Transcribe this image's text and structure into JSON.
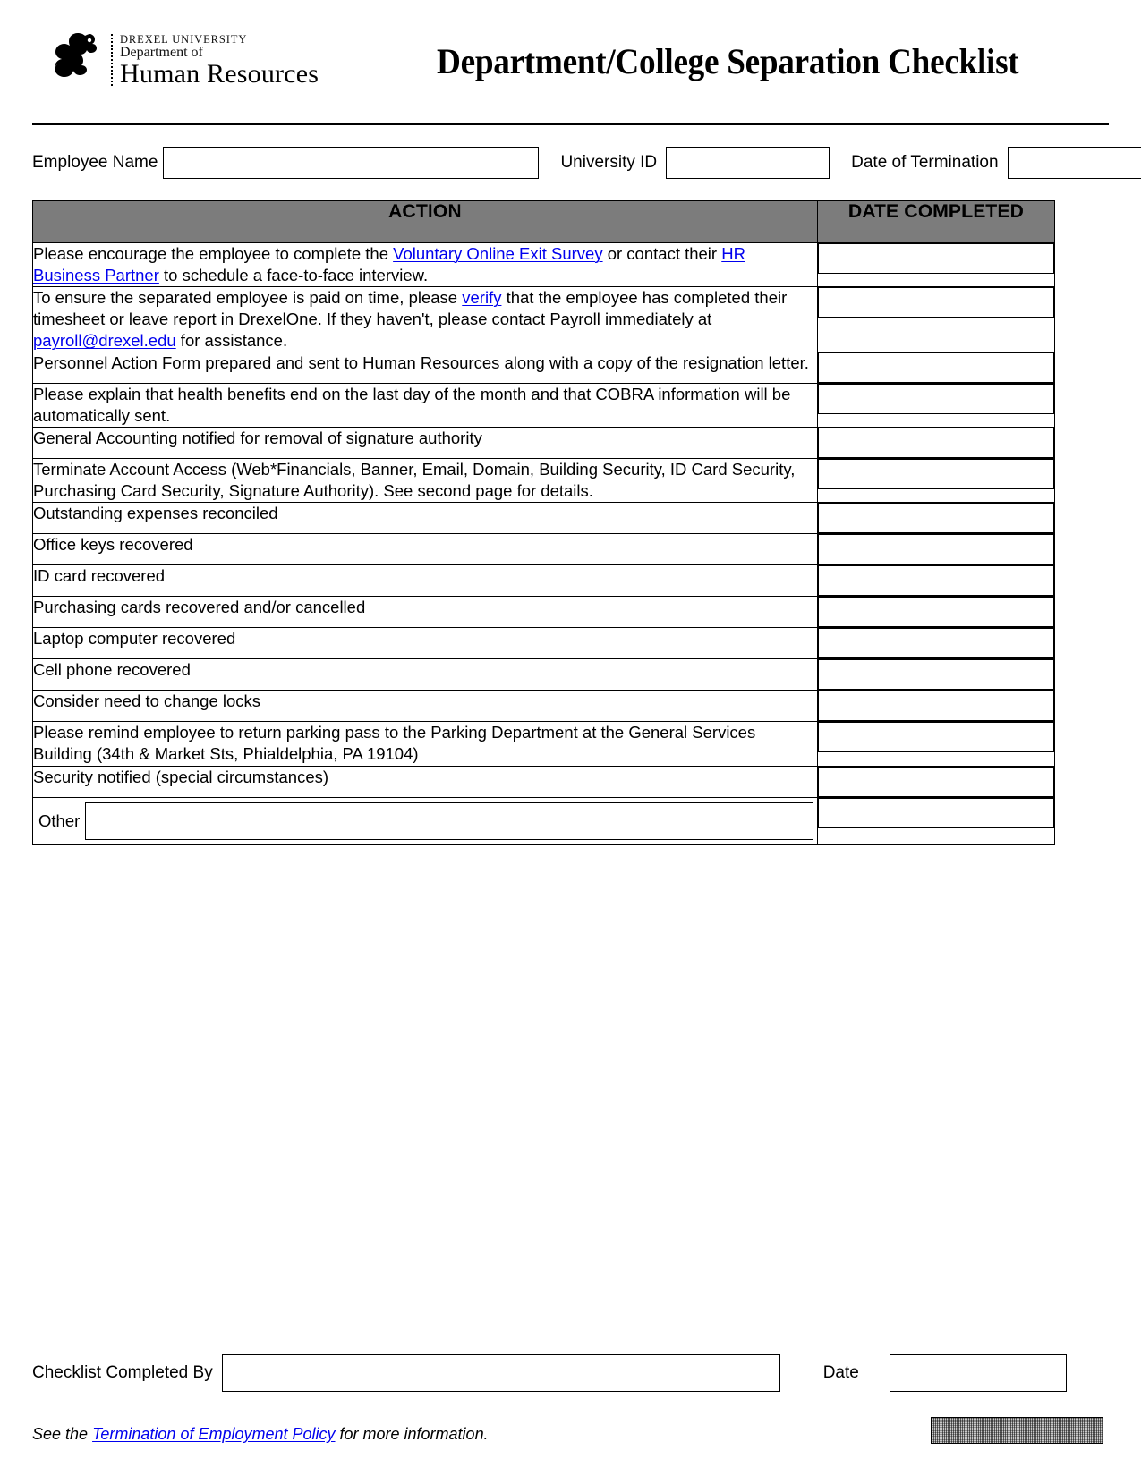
{
  "header": {
    "logo": {
      "line1": "DREXEL UNIVERSITY",
      "line2": "Department of",
      "line3": "Human Resources",
      "mark": "drexel-dragon-logo"
    },
    "title": "Department/College Separation Checklist"
  },
  "top_fields": {
    "employee_name_label": "Employee Name",
    "employee_name_value": "",
    "university_id_label": "University ID",
    "university_id_value": "",
    "date_of_termination_label": "Date of Termination",
    "date_of_termination_value": ""
  },
  "table": {
    "columns": {
      "action": "ACTION",
      "date_completed": "DATE COMPLETED"
    },
    "rows": [
      {
        "id": "exit-survey",
        "segments": [
          {
            "text": "Please encourage the employee to complete the ",
            "link": false
          },
          {
            "text": "Voluntary Online Exit Survey",
            "link": true
          },
          {
            "text": " or contact their ",
            "link": false
          },
          {
            "text": "HR Business Partner",
            "link": true
          },
          {
            "text": " to schedule a face-to-face interview.",
            "link": false
          }
        ],
        "date_value": ""
      },
      {
        "id": "timesheet-payroll",
        "segments": [
          {
            "text": "To ensure the separated employee is paid on time,  please ",
            "link": false
          },
          {
            "text": "verify",
            "link": true
          },
          {
            "text": " that the employee has completed their timesheet or leave report in DrexelOne. If they haven't, please contact Payroll immediately at ",
            "link": false
          },
          {
            "text": "payroll@drexel.edu",
            "link": true
          },
          {
            "text": " for assistance.",
            "link": false
          }
        ],
        "date_value": ""
      },
      {
        "id": "personnel-action-form",
        "segments": [
          {
            "text": "Personnel Action Form prepared and sent to Human Resources along with a copy of the resignation letter.",
            "link": false
          }
        ],
        "date_value": ""
      },
      {
        "id": "health-benefits-cobra",
        "segments": [
          {
            "text": "Please explain that health benefits end on the last day of the month and that COBRA information will be automatically sent.",
            "link": false
          }
        ],
        "date_value": ""
      },
      {
        "id": "general-accounting",
        "segments": [
          {
            "text": "General Accounting notified for removal of signature authority",
            "link": false
          }
        ],
        "date_value": ""
      },
      {
        "id": "terminate-account-access",
        "segments": [
          {
            "text": "Terminate Account Access (Web*Financials, Banner, Email, Domain, Building Security, ID Card Security, Purchasing Card Security, Signature Authority).  See second page for details.",
            "link": false
          }
        ],
        "date_value": ""
      },
      {
        "id": "expenses-reconciled",
        "segments": [
          {
            "text": "Outstanding expenses reconciled",
            "link": false
          }
        ],
        "date_value": ""
      },
      {
        "id": "office-keys",
        "segments": [
          {
            "text": "Office keys recovered",
            "link": false
          }
        ],
        "date_value": ""
      },
      {
        "id": "id-card",
        "segments": [
          {
            "text": "ID card recovered",
            "link": false
          }
        ],
        "date_value": ""
      },
      {
        "id": "purchasing-cards",
        "segments": [
          {
            "text": "Purchasing cards recovered and/or cancelled",
            "link": false
          }
        ],
        "date_value": ""
      },
      {
        "id": "laptop",
        "segments": [
          {
            "text": "Laptop computer recovered",
            "link": false
          }
        ],
        "date_value": ""
      },
      {
        "id": "cell-phone",
        "segments": [
          {
            "text": "Cell phone recovered",
            "link": false
          }
        ],
        "date_value": ""
      },
      {
        "id": "change-locks",
        "segments": [
          {
            "text": "Consider need to change locks",
            "link": false
          }
        ],
        "date_value": ""
      },
      {
        "id": "parking-pass",
        "segments": [
          {
            "text": "Please remind employee to return parking pass to the Parking Department at the General Services Building (34th & Market Sts, Phialdelphia, PA 19104)",
            "link": false
          }
        ],
        "date_value": ""
      },
      {
        "id": "security-notified",
        "segments": [
          {
            "text": "Security notified (special circumstances)",
            "link": false
          }
        ],
        "date_value": ""
      }
    ],
    "other_row": {
      "label": "Other",
      "value": "",
      "date_value": ""
    }
  },
  "footer": {
    "completed_by_label": "Checklist Completed By",
    "completed_by_value": "",
    "date_label": "Date",
    "date_value": "",
    "note_prefix": "See the ",
    "note_link": "Termination of Employment Policy",
    "note_suffix": " for more information.",
    "print_button_label": ""
  }
}
